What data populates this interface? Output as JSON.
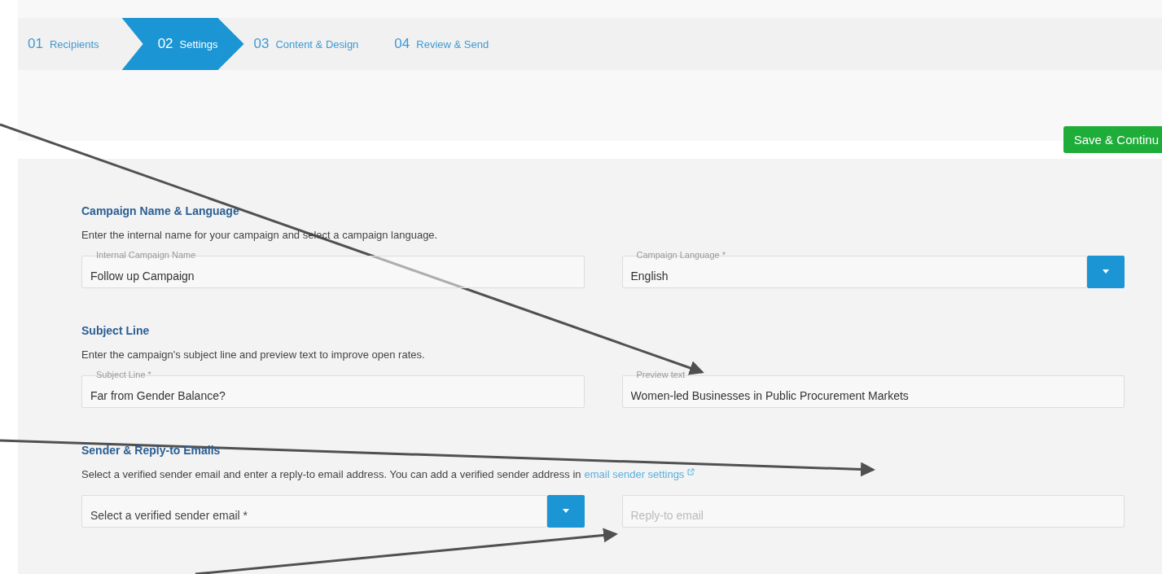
{
  "steps": [
    {
      "number": "01",
      "label": "Recipients",
      "selected": false
    },
    {
      "number": "02",
      "label": "Settings",
      "selected": true
    },
    {
      "number": "03",
      "label": "Content & Design",
      "selected": false
    },
    {
      "number": "04",
      "label": "Review & Send",
      "selected": false
    }
  ],
  "save_button": "Save & Continu",
  "sections": [
    {
      "title": "Campaign Name & Language",
      "description": "Enter the internal name for your campaign and select a campaign language.",
      "fields": [
        {
          "kind": "text",
          "label": "Internal Campaign Name",
          "value": "Follow up Campaign"
        },
        {
          "kind": "select",
          "label": "Campaign Language *",
          "value": "English"
        }
      ]
    },
    {
      "title": "Subject Line",
      "description": "Enter the campaign's subject line and preview text to improve open rates.",
      "fields": [
        {
          "kind": "text",
          "label": "Subject Line *",
          "value": "Far from Gender Balance?"
        },
        {
          "kind": "text",
          "label": "Preview text",
          "value": "Women-led Businesses in Public Procurement Markets"
        }
      ]
    },
    {
      "title": "Sender & Reply-to Emails",
      "description": "Select a verified sender email and enter a reply-to email address. You can add a verified sender address in",
      "link": "email sender settings",
      "fields": [
        {
          "kind": "select",
          "placeholder": "Select a verified sender email *"
        },
        {
          "kind": "text",
          "placeholder": "Reply-to email"
        }
      ]
    }
  ]
}
